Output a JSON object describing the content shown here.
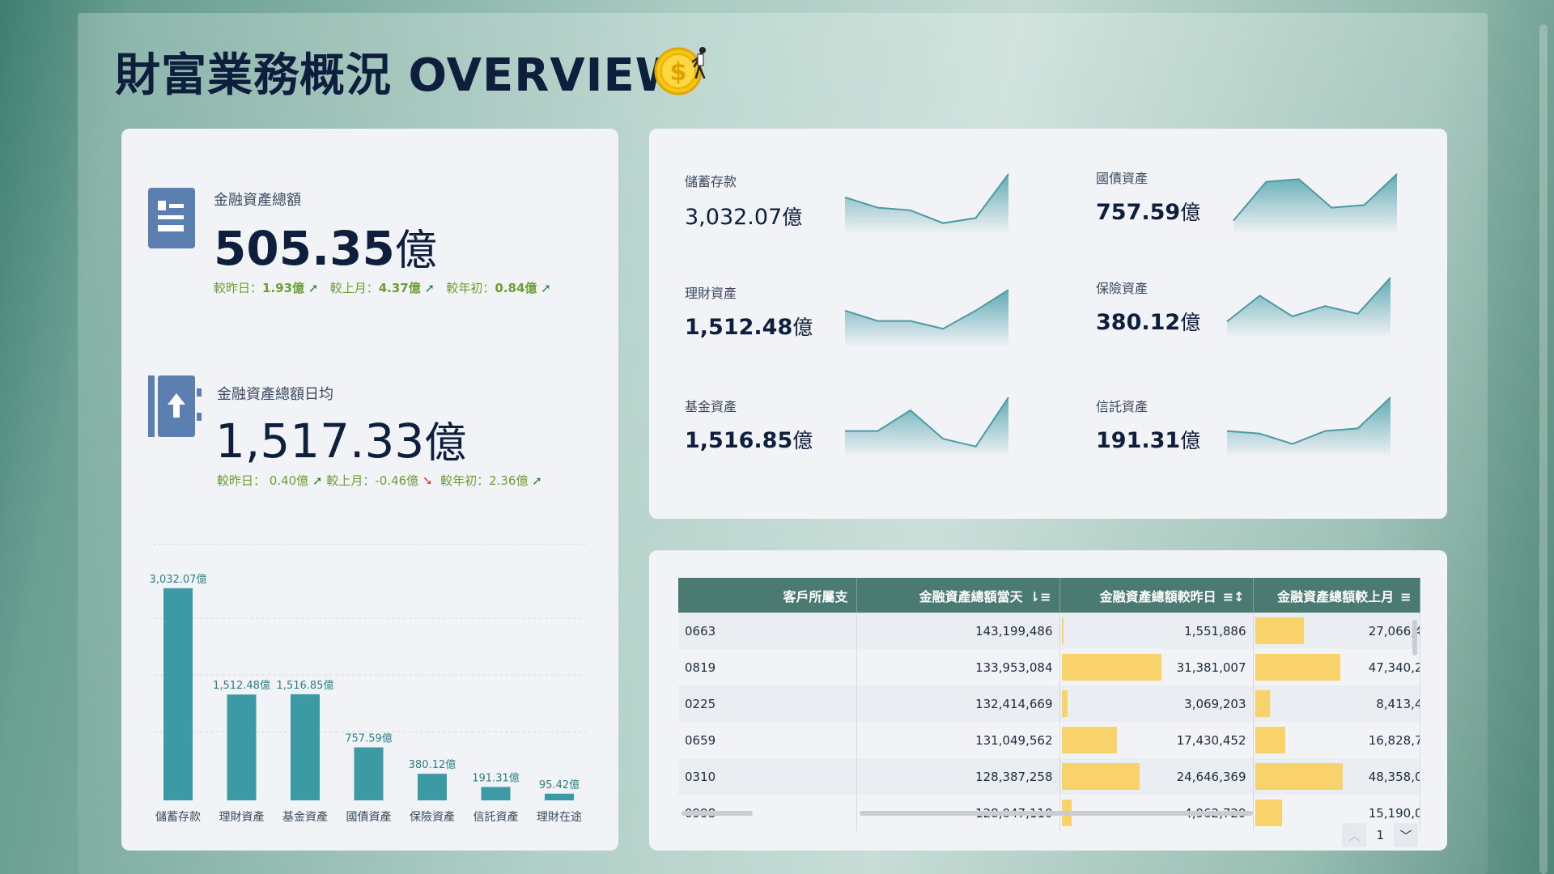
{
  "page": {
    "title": "財富業務概況  OVERVIEW"
  },
  "kpi_total": {
    "label": "金融資產總額",
    "value": "505.35",
    "unit": "億",
    "compare": [
      {
        "label": "較昨日：",
        "value": "1.93億",
        "dir": "up"
      },
      {
        "label": "較上月：",
        "value": "4.37億",
        "dir": "up"
      },
      {
        "label": "較年初：",
        "value": "0.84億",
        "dir": "up"
      }
    ]
  },
  "kpi_daily": {
    "label": "金融資產總額日均",
    "value": "1,517.33",
    "unit": "億",
    "compare": [
      {
        "label": "較昨日：",
        "value": " 0.40億",
        "dir": "up"
      },
      {
        "label": "較上月：",
        "value": "-0.46億",
        "dir": "down"
      },
      {
        "label": "較年初：",
        "value": "2.36億",
        "dir": "up"
      }
    ]
  },
  "colors": {
    "bar": "#3b9aa3",
    "up": "#1f8a2f",
    "down": "#e0363b",
    "header": "#4b7a72",
    "databar": "#f8d36b"
  },
  "chart_data": {
    "type": "bar",
    "categories": [
      "儲蓄存款",
      "理財資產",
      "基金資產",
      "國債資產",
      "保險資產",
      "信託資產",
      "理財在途"
    ],
    "values": [
      3032.07,
      1512.48,
      1516.85,
      757.59,
      380.12,
      191.31,
      95.42
    ],
    "data_labels": [
      "3,032.07億",
      "1,512.48億",
      "1,516.85億",
      "757.59億",
      "380.12億",
      "191.31億",
      "95.42億"
    ],
    "ylim": [
      0,
      3200
    ],
    "grid": true,
    "title": "",
    "xlabel": "",
    "ylabel": ""
  },
  "mini_kpis": [
    {
      "label": "儲蓄存款",
      "value": "3,032.07",
      "unit": "億",
      "bold": false,
      "trend": [
        0.55,
        0.35,
        0.3,
        0.05,
        0.15,
        1.0
      ]
    },
    {
      "label": "國債資產",
      "value": "757.59",
      "unit": "億",
      "bold": true,
      "trend": [
        0.1,
        0.85,
        0.9,
        0.35,
        0.4,
        1.0
      ]
    },
    {
      "label": "理財資產",
      "value": "1,512.48",
      "unit": "億",
      "bold": true,
      "trend": [
        0.55,
        0.35,
        0.35,
        0.2,
        0.55,
        0.95
      ]
    },
    {
      "label": "保險資產",
      "value": "380.12",
      "unit": "億",
      "bold": true,
      "trend": [
        0.15,
        0.65,
        0.25,
        0.45,
        0.3,
        1.0
      ]
    },
    {
      "label": "基金資產",
      "value": "1,516.85",
      "unit": "億",
      "bold": true,
      "trend": [
        0.35,
        0.35,
        0.75,
        0.2,
        0.05,
        1.0
      ]
    },
    {
      "label": "信託資產",
      "value": "191.31",
      "unit": "億",
      "bold": true,
      "trend": [
        0.35,
        0.3,
        0.1,
        0.35,
        0.4,
        1.0
      ]
    }
  ],
  "table": {
    "headers": [
      "客戶所屬支",
      "金融資產總額當天",
      "金融資產總額較昨日",
      "金融資產總額較上月"
    ],
    "rows": [
      {
        "branch": "0663",
        "today": "143,199,486",
        "vs_yesterday": "1,551,886",
        "vs_yesterday_ratio": 0.02,
        "vs_month": "27,066,4",
        "vs_month_ratio": 0.56
      },
      {
        "branch": "0819",
        "today": "133,953,084",
        "vs_yesterday": "31,381,007",
        "vs_yesterday_ratio": 1.0,
        "vs_month": "47,340,2",
        "vs_month_ratio": 0.98
      },
      {
        "branch": "0225",
        "today": "132,414,669",
        "vs_yesterday": "3,069,203",
        "vs_yesterday_ratio": 0.06,
        "vs_month": "8,413,4",
        "vs_month_ratio": 0.17
      },
      {
        "branch": "0659",
        "today": "131,049,562",
        "vs_yesterday": "17,430,452",
        "vs_yesterday_ratio": 0.55,
        "vs_month": "16,828,7",
        "vs_month_ratio": 0.35
      },
      {
        "branch": "0310",
        "today": "128,387,258",
        "vs_yesterday": "24,646,369",
        "vs_yesterday_ratio": 0.78,
        "vs_month": "48,358,0",
        "vs_month_ratio": 1.0
      },
      {
        "branch": "0998",
        "today": "128,047,110",
        "vs_yesterday": "4,962,729",
        "vs_yesterday_ratio": 0.1,
        "vs_month": "15,190,0",
        "vs_month_ratio": 0.31
      }
    ],
    "page": "1"
  }
}
